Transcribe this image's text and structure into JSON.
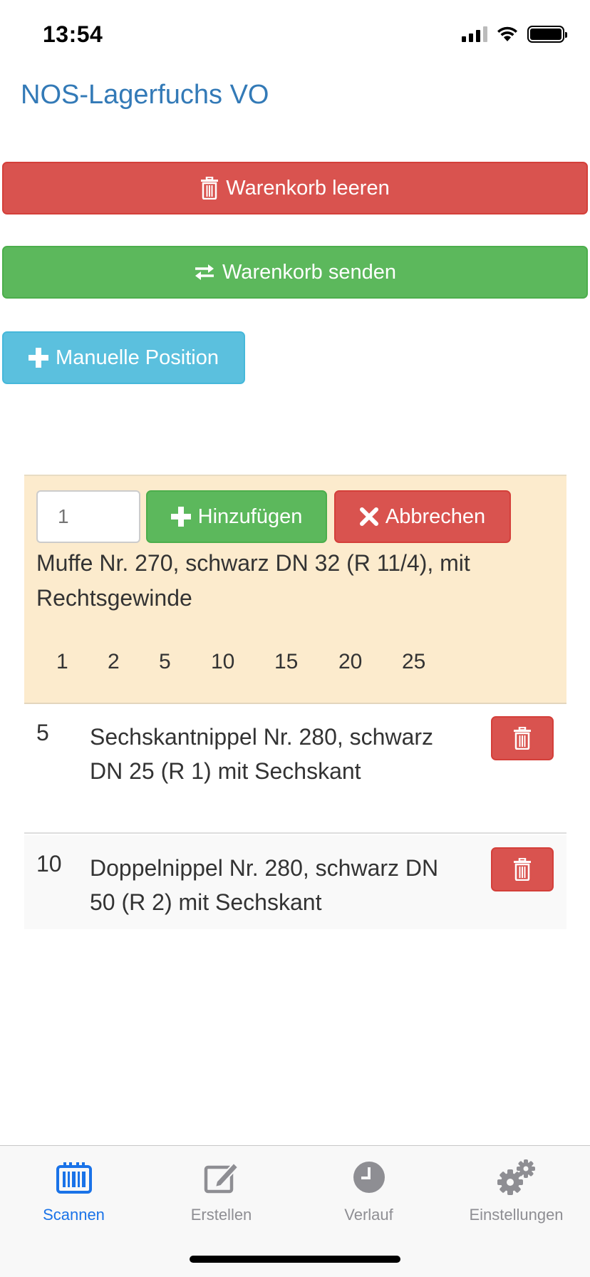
{
  "status_bar": {
    "time": "13:54"
  },
  "app": {
    "title": "NOS-Lagerfuchs VO"
  },
  "actions": {
    "clear_label": "Warenkorb leeren",
    "send_label": "Warenkorb senden",
    "manual_label": "Manuelle Position"
  },
  "active_item": {
    "quantity_placeholder": "1",
    "add_label": "Hinzufügen",
    "cancel_label": "Abbrechen",
    "description": "Muffe Nr. 270, schwarz DN 32 (R 11/4), mit Rechtsgewinde",
    "quantity_options": [
      "1",
      "2",
      "5",
      "10",
      "15",
      "20",
      "25"
    ]
  },
  "cart_items": [
    {
      "qty": "5",
      "description": "Sechskantnippel Nr. 280, schwarz DN 25 (R 1) mit Sechskant"
    },
    {
      "qty": "10",
      "description": "Doppelnippel Nr. 280, schwarz DN 50 (R 2) mit Sechskant"
    }
  ],
  "tabs": [
    {
      "label": "Scannen",
      "icon": "barcode-scan-icon",
      "active": true
    },
    {
      "label": "Erstellen",
      "icon": "edit-icon",
      "active": false
    },
    {
      "label": "Verlauf",
      "icon": "clock-icon",
      "active": false
    },
    {
      "label": "Einstellungen",
      "icon": "gears-icon",
      "active": false
    }
  ],
  "colors": {
    "title_blue": "#337ab7",
    "danger": "#d9534f",
    "success": "#5cb85c",
    "info": "#5bc0de",
    "panel_warning": "#fcebcd",
    "tab_active": "#1a73e8",
    "tab_inactive": "#8e8e93"
  }
}
